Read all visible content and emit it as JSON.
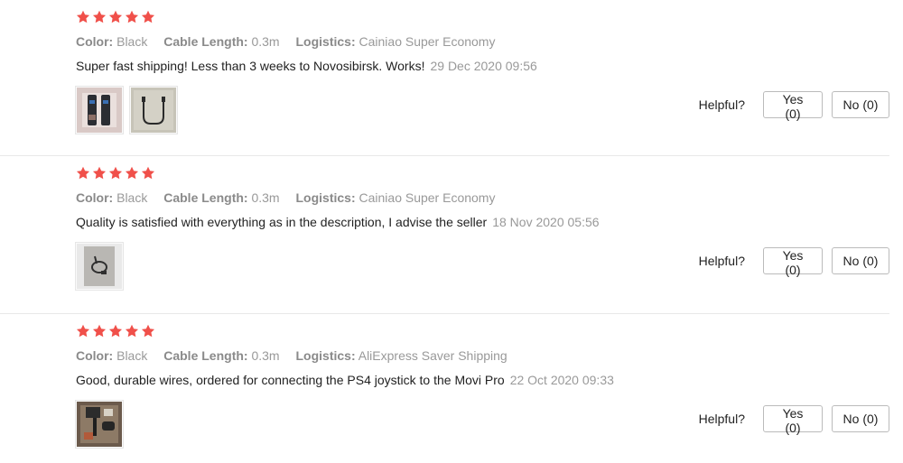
{
  "reviews": [
    {
      "rating": 5,
      "color_label": "Color:",
      "color_value": "Black",
      "cable_label": "Cable Length:",
      "cable_value": "0.3m",
      "logistics_label": "Logistics:",
      "logistics_value": "Cainiao Super Economy",
      "text": "Super fast shipping! Less than 3 weeks to Novosibirsk. Works!",
      "date": "29 Dec 2020 09:56",
      "helpful_label": "Helpful?",
      "yes_label": "Yes (0)",
      "no_label": "No (0)"
    },
    {
      "rating": 5,
      "color_label": "Color:",
      "color_value": "Black",
      "cable_label": "Cable Length:",
      "cable_value": "0.3m",
      "logistics_label": "Logistics:",
      "logistics_value": "Cainiao Super Economy",
      "text": "Quality is satisfied with everything as in the description, I advise the seller",
      "date": "18 Nov 2020 05:56",
      "helpful_label": "Helpful?",
      "yes_label": "Yes (0)",
      "no_label": "No (0)"
    },
    {
      "rating": 5,
      "color_label": "Color:",
      "color_value": "Black",
      "cable_label": "Cable Length:",
      "cable_value": "0.3m",
      "logistics_label": "Logistics:",
      "logistics_value": "AliExpress Saver Shipping",
      "text": "Good, durable wires, ordered for connecting the PS4 joystick to the Movi Pro",
      "date": "22 Oct 2020 09:33",
      "helpful_label": "Helpful?",
      "yes_label": "Yes (0)",
      "no_label": "No (0)"
    }
  ],
  "colors": {
    "star": "#f0504a",
    "label": "#8a8a8a",
    "muted": "#999999"
  }
}
